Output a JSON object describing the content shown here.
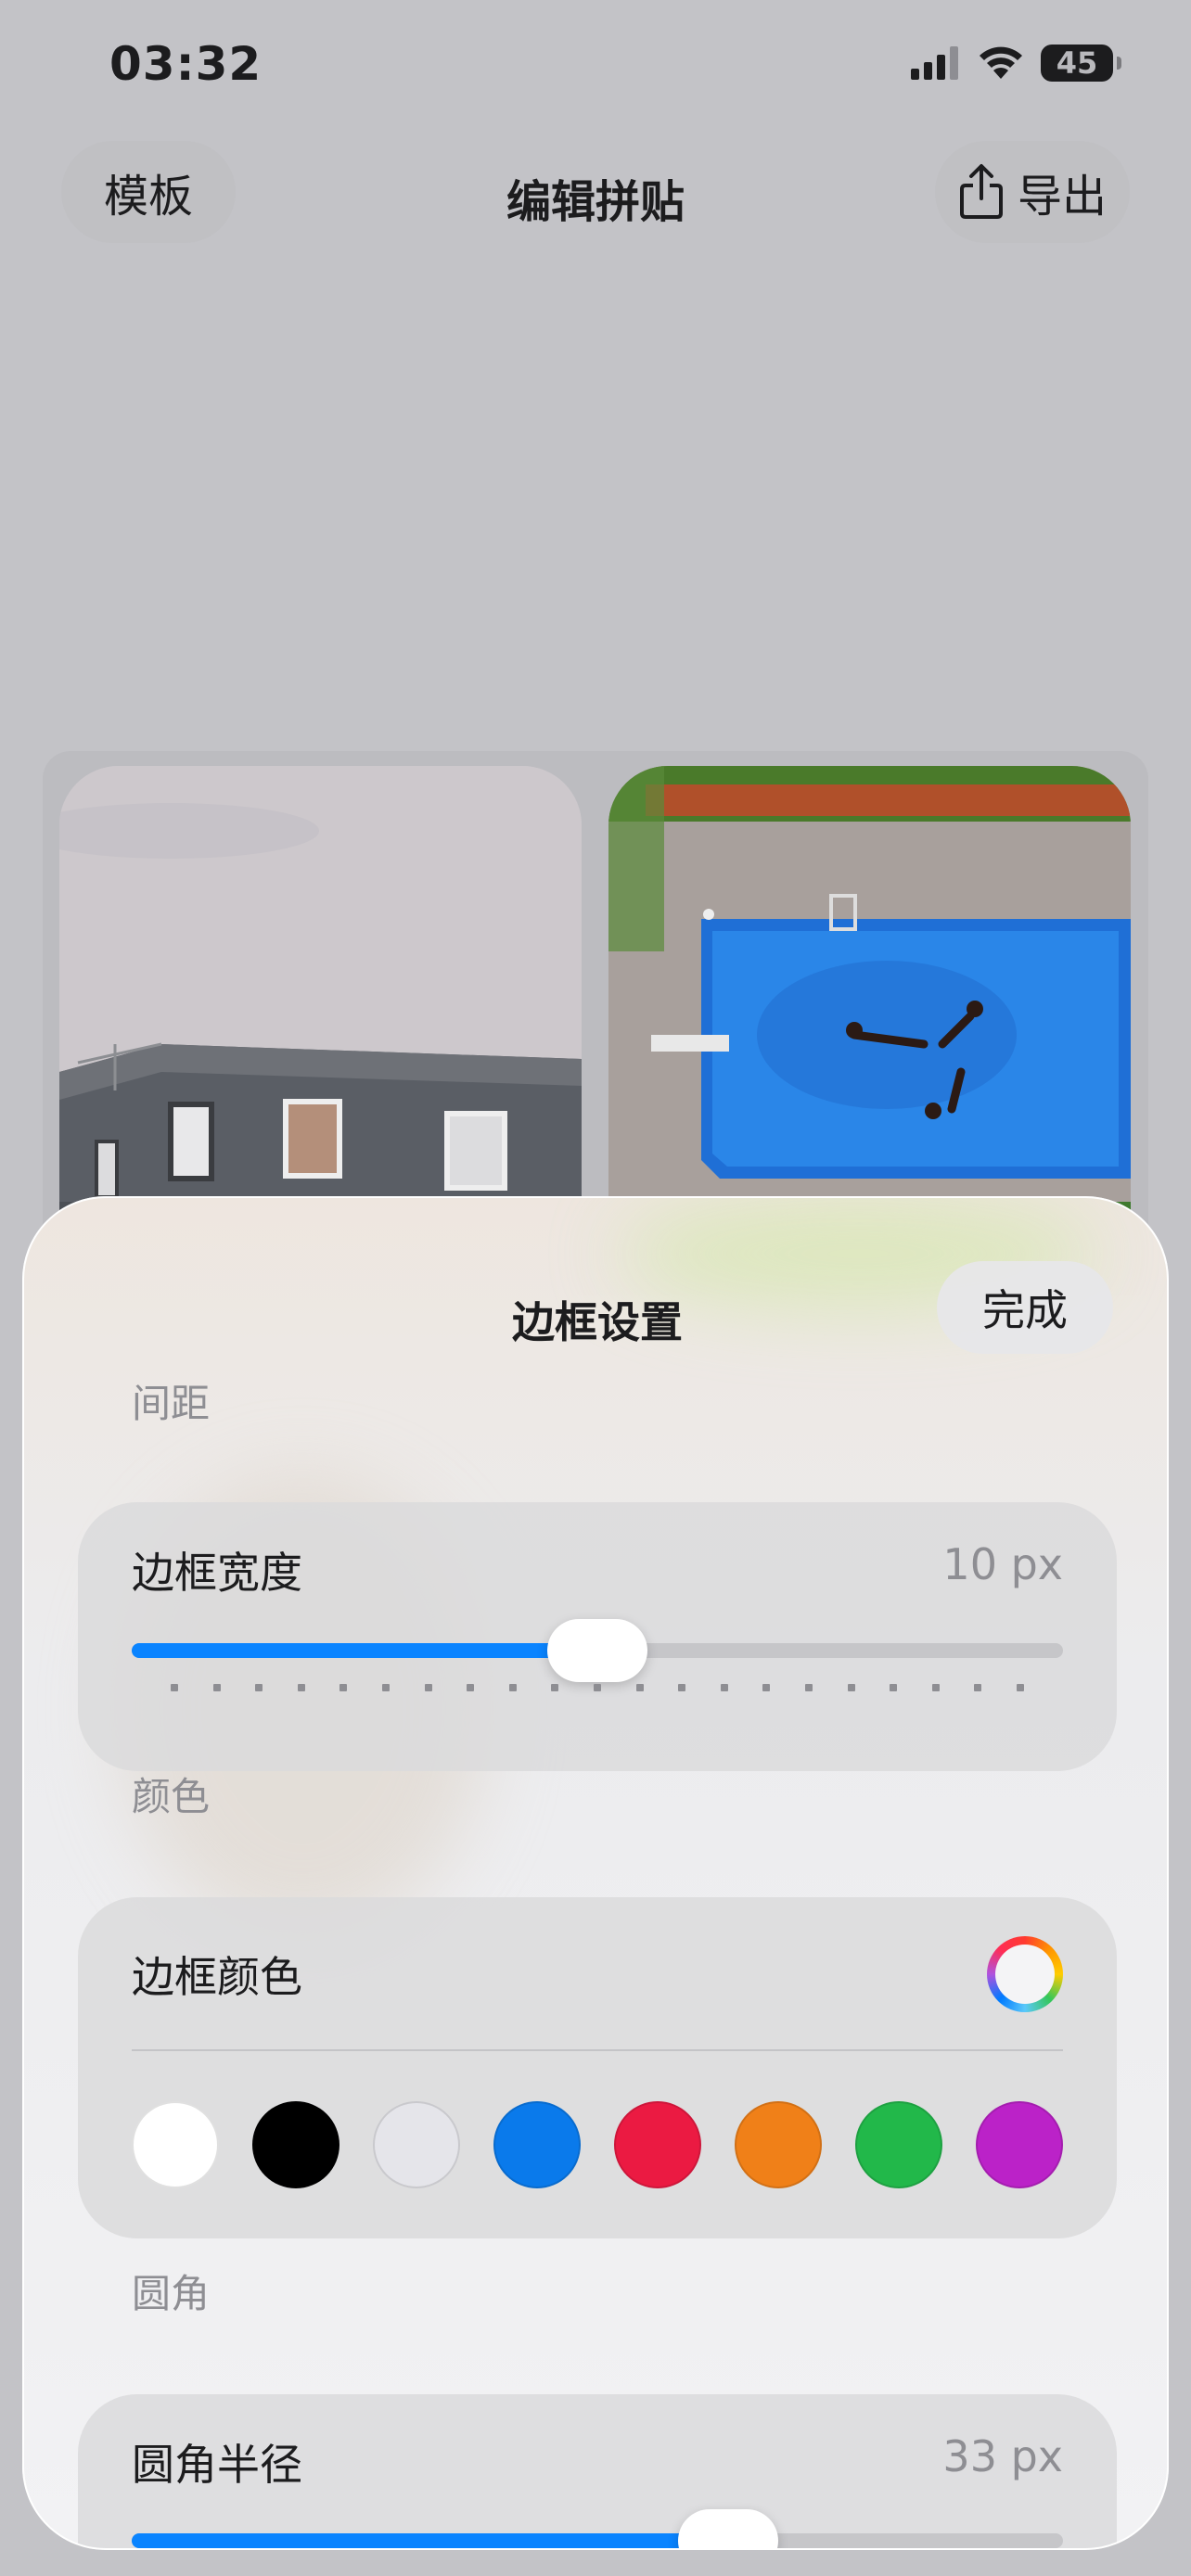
{
  "status_bar": {
    "time": "03:32",
    "battery": "45"
  },
  "nav": {
    "left_button": "模板",
    "title": "编辑拼贴",
    "right_button": "导出"
  },
  "sheet": {
    "title": "边框设置",
    "done_button": "完成",
    "spacing": {
      "section": "间距",
      "label": "边框宽度",
      "value": "10 px",
      "fill_fraction": 0.5
    },
    "color": {
      "section": "颜色",
      "label": "边框颜色",
      "swatches": [
        {
          "name": "white",
          "hex": "#ffffff"
        },
        {
          "name": "black",
          "hex": "#000000"
        },
        {
          "name": "light-gray",
          "hex": "#e5e5ea"
        },
        {
          "name": "blue",
          "hex": "#0a7aeb"
        },
        {
          "name": "red",
          "hex": "#eb1a42"
        },
        {
          "name": "orange",
          "hex": "#f08018"
        },
        {
          "name": "green",
          "hex": "#22b84a"
        },
        {
          "name": "purple",
          "hex": "#bb22c8"
        }
      ]
    },
    "corner": {
      "section": "圆角",
      "label": "圆角半径",
      "value": "33 px",
      "fill_fraction": 0.64
    }
  },
  "colors": {
    "accent": "#0a84ff",
    "secondary_text": "#8e8e93"
  }
}
